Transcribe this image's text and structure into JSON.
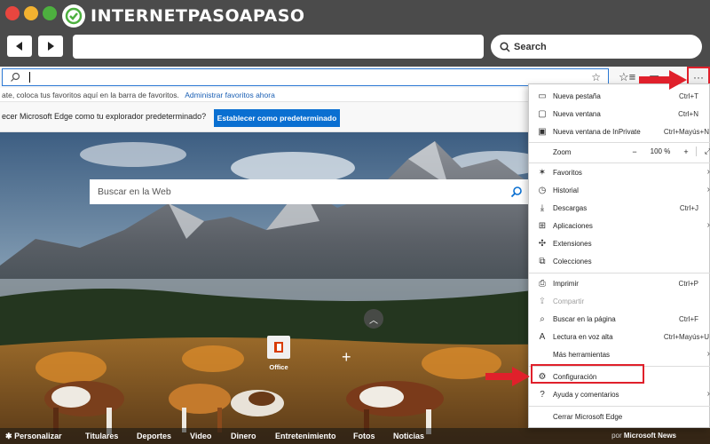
{
  "brand": {
    "part1": "INTERNET",
    "part2": "PASO",
    "part3": "A",
    "part4": "PASO"
  },
  "frame": {
    "search_label": "Search"
  },
  "browser": {
    "favorites_hint": "ate, coloca tus favoritos aquí en la barra de favoritos.",
    "favorites_link": "Administrar favoritos ahora",
    "default_prompt": "ecer Microsoft Edge como tu explorador predeterminado?",
    "default_button": "Establecer como predeterminado",
    "more_button": "···"
  },
  "page": {
    "web_search_placeholder": "Buscar en la Web",
    "office_label": "Office",
    "news": [
      "Personalizar",
      "Titulares",
      "Deportes",
      "Video",
      "Dinero",
      "Entretenimiento",
      "Fotos",
      "Noticias"
    ],
    "news_powered_prefix": "por",
    "news_powered_brand": "Microsoft News"
  },
  "menu": {
    "items": [
      {
        "label": "Nueva pestaña",
        "shortcut": "Ctrl+T"
      },
      {
        "label": "Nueva ventana",
        "shortcut": "Ctrl+N"
      },
      {
        "label": "Nueva ventana de InPrivate",
        "shortcut": "Ctrl+Mayús+N"
      },
      {
        "label": "Zoom",
        "zoom_minus": "−",
        "zoom_value": "100 %",
        "zoom_plus": "+",
        "zoom_expand": "⤢"
      },
      {
        "label": "Favoritos"
      },
      {
        "label": "Historial"
      },
      {
        "label": "Descargas",
        "shortcut": "Ctrl+J"
      },
      {
        "label": "Aplicaciones"
      },
      {
        "label": "Extensiones"
      },
      {
        "label": "Colecciones"
      },
      {
        "label": "Imprimir",
        "shortcut": "Ctrl+P"
      },
      {
        "label": "Compartir"
      },
      {
        "label": "Buscar en la página",
        "shortcut": "Ctrl+F"
      },
      {
        "label": "Lectura en voz alta",
        "shortcut": "Ctrl+Mayús+U"
      },
      {
        "label": "Más herramientas"
      },
      {
        "label": "Configuración"
      },
      {
        "label": "Ayuda y comentarios"
      },
      {
        "label": "Cerrar Microsoft Edge"
      }
    ]
  },
  "colors": {
    "highlight": "#e0202b",
    "accent": "#0a6fd1",
    "frame": "#4b4b4b"
  }
}
